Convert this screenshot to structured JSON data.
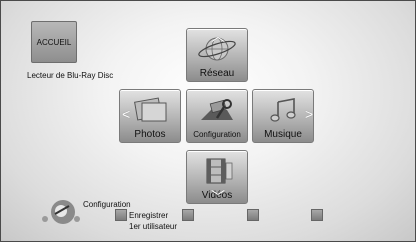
{
  "home": {
    "title": "ACCUEIL",
    "device": "Lecteur de Blu-Ray Disc"
  },
  "menu": {
    "network": "Réseau",
    "photos": "Photos",
    "config": "Configuration",
    "music": "Musique",
    "videos": "Vidéos"
  },
  "footer": {
    "config_label": "Configuration",
    "register_line1": "Enregistrer",
    "register_line2": "1er utilisateur"
  },
  "icons": {
    "network": "globe-icon",
    "photos": "photo-frames-icon",
    "config": "settings-tools-icon",
    "music": "music-notes-icon",
    "videos": "film-strip-icon"
  }
}
